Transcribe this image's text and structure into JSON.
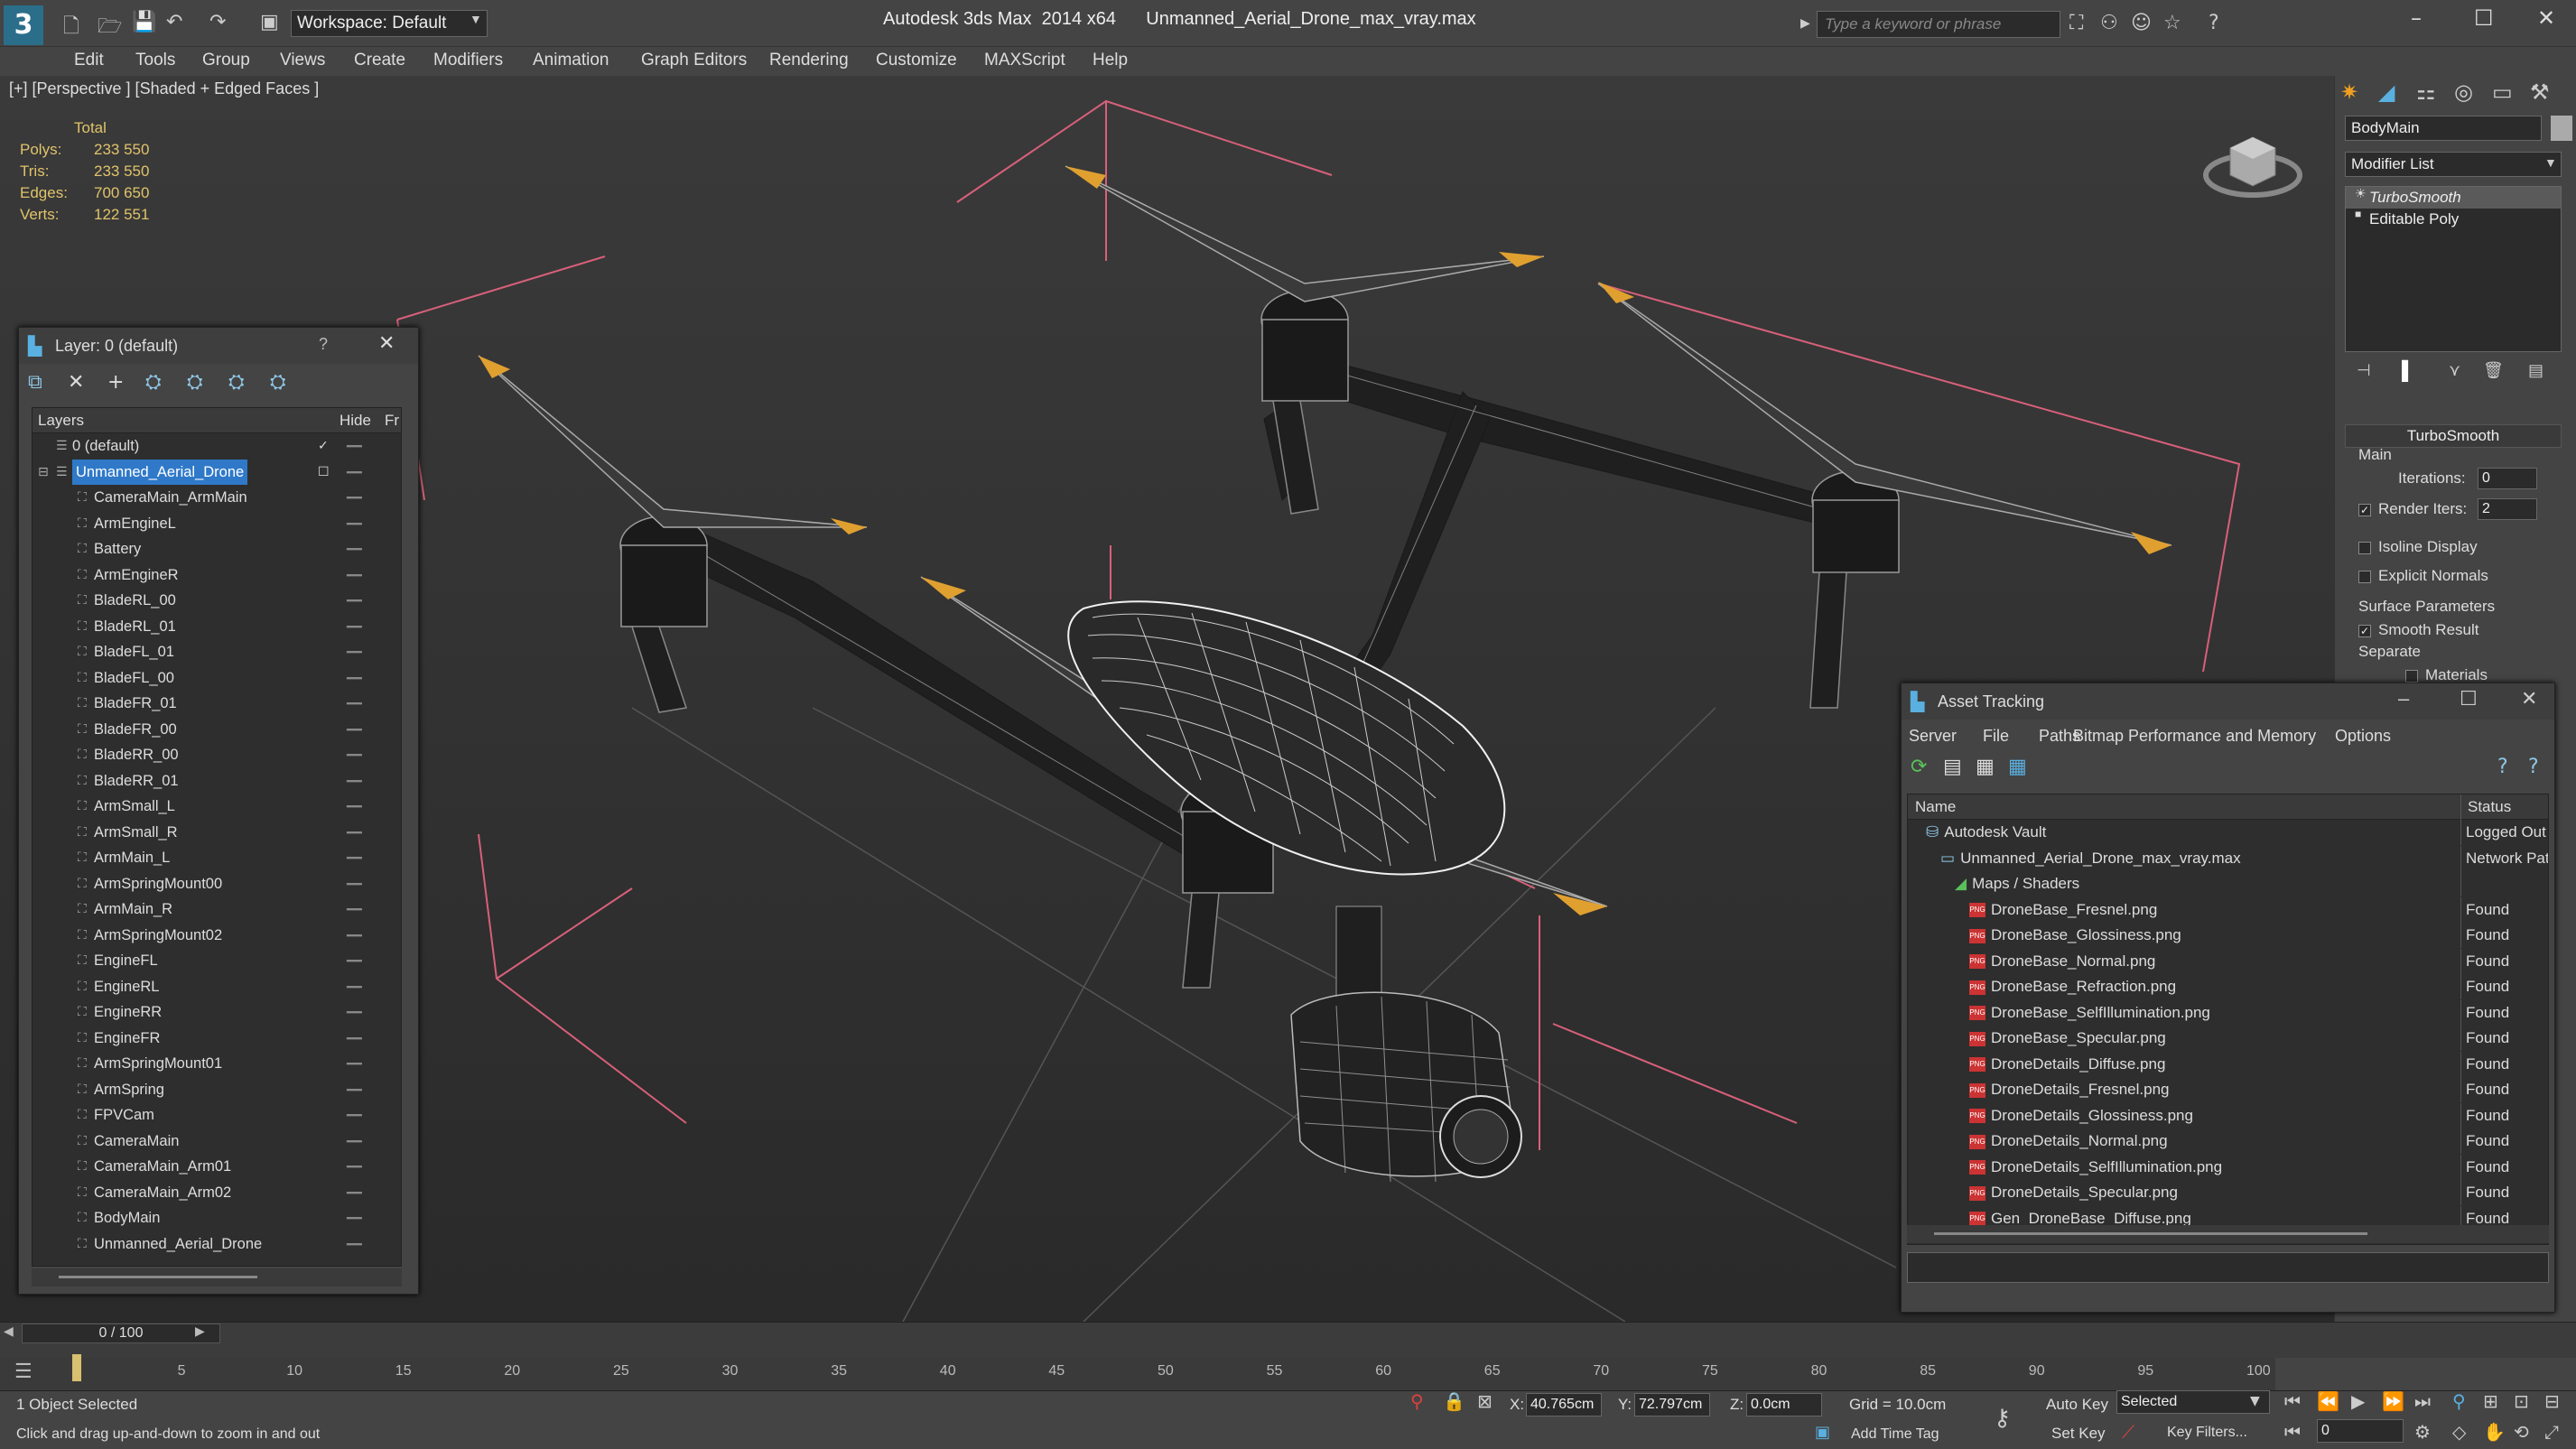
{
  "title": {
    "workspace": "Workspace: Default",
    "app": "Autodesk 3ds Max  2014 x64",
    "file": "Unmanned_Aerial_Drone_max_vray.max",
    "search_placeholder": "Type a keyword or phrase"
  },
  "menu": [
    "Edit",
    "Tools",
    "Group",
    "Views",
    "Create",
    "Modifiers",
    "Animation",
    "Graph Editors",
    "Rendering",
    "Customize",
    "MAXScript",
    "Help"
  ],
  "viewport": {
    "label": "[+] [Perspective ] [Shaded + Edged Faces ]",
    "stats_header": "Total",
    "stats": [
      {
        "k": "Polys:",
        "v": "233 550"
      },
      {
        "k": "Tris:",
        "v": "233 550"
      },
      {
        "k": "Edges:",
        "v": "700 650"
      },
      {
        "k": "Verts:",
        "v": "122 551"
      }
    ]
  },
  "layer_manager": {
    "title": "Layer: 0 (default)",
    "help": "?",
    "col_layers": "Layers",
    "col_hide": "Hide",
    "col_freeze": "Fr",
    "rows": [
      {
        "name": "0 (default)",
        "level": 1
      },
      {
        "name": "Unmanned_Aerial_Drone",
        "level": 1,
        "selected": true
      },
      {
        "name": "CameraMain_ArmMain",
        "level": 2
      },
      {
        "name": "ArmEngineL",
        "level": 2
      },
      {
        "name": "Battery",
        "level": 2
      },
      {
        "name": "ArmEngineR",
        "level": 2
      },
      {
        "name": "BladeRL_00",
        "level": 2
      },
      {
        "name": "BladeRL_01",
        "level": 2
      },
      {
        "name": "BladeFL_01",
        "level": 2
      },
      {
        "name": "BladeFL_00",
        "level": 2
      },
      {
        "name": "BladeFR_01",
        "level": 2
      },
      {
        "name": "BladeFR_00",
        "level": 2
      },
      {
        "name": "BladeRR_00",
        "level": 2
      },
      {
        "name": "BladeRR_01",
        "level": 2
      },
      {
        "name": "ArmSmall_L",
        "level": 2
      },
      {
        "name": "ArmSmall_R",
        "level": 2
      },
      {
        "name": "ArmMain_L",
        "level": 2
      },
      {
        "name": "ArmSpringMount00",
        "level": 2
      },
      {
        "name": "ArmMain_R",
        "level": 2
      },
      {
        "name": "ArmSpringMount02",
        "level": 2
      },
      {
        "name": "EngineFL",
        "level": 2
      },
      {
        "name": "EngineRL",
        "level": 2
      },
      {
        "name": "EngineRR",
        "level": 2
      },
      {
        "name": "EngineFR",
        "level": 2
      },
      {
        "name": "ArmSpringMount01",
        "level": 2
      },
      {
        "name": "ArmSpring",
        "level": 2
      },
      {
        "name": "FPVCam",
        "level": 2
      },
      {
        "name": "CameraMain",
        "level": 2
      },
      {
        "name": "CameraMain_Arm01",
        "level": 2
      },
      {
        "name": "CameraMain_Arm02",
        "level": 2
      },
      {
        "name": "BodyMain",
        "level": 2
      },
      {
        "name": "Unmanned_Aerial_Drone",
        "level": 2
      }
    ]
  },
  "command_panel": {
    "object_name": "BodyMain",
    "modifier_list": "Modifier List",
    "stack": [
      "TurboSmooth",
      "Editable Poly"
    ],
    "rollout_title": "TurboSmooth",
    "main_label": "Main",
    "iterations_label": "Iterations:",
    "iterations_value": "0",
    "render_iters_label": "Render Iters:",
    "render_iters_value": "2",
    "isoline": "Isoline Display",
    "explicit_normals": "Explicit Normals",
    "surface_params": "Surface Parameters",
    "smooth_result": "Smooth Result",
    "separate": "Separate",
    "materials": "Materials"
  },
  "asset_tracking": {
    "title": "Asset Tracking",
    "menu": [
      "Server",
      "File",
      "Paths",
      "Bitmap Performance and Memory",
      "Options"
    ],
    "col_name": "Name",
    "col_status": "Status",
    "rows": [
      {
        "name": "Autodesk Vault",
        "status": "Logged Out",
        "indent": 1,
        "icon": "vault"
      },
      {
        "name": "Unmanned_Aerial_Drone_max_vray.max",
        "status": "Network Pat",
        "indent": 2,
        "icon": "max"
      },
      {
        "name": "Maps / Shaders",
        "status": "",
        "indent": 3,
        "icon": "maps"
      },
      {
        "name": "DroneBase_Fresnel.png",
        "status": "Found",
        "indent": 4,
        "icon": "png"
      },
      {
        "name": "DroneBase_Glossiness.png",
        "status": "Found",
        "indent": 4,
        "icon": "png"
      },
      {
        "name": "DroneBase_Normal.png",
        "status": "Found",
        "indent": 4,
        "icon": "png"
      },
      {
        "name": "DroneBase_Refraction.png",
        "status": "Found",
        "indent": 4,
        "icon": "png"
      },
      {
        "name": "DroneBase_SelfIllumination.png",
        "status": "Found",
        "indent": 4,
        "icon": "png"
      },
      {
        "name": "DroneBase_Specular.png",
        "status": "Found",
        "indent": 4,
        "icon": "png"
      },
      {
        "name": "DroneDetails_Diffuse.png",
        "status": "Found",
        "indent": 4,
        "icon": "png"
      },
      {
        "name": "DroneDetails_Fresnel.png",
        "status": "Found",
        "indent": 4,
        "icon": "png"
      },
      {
        "name": "DroneDetails_Glossiness.png",
        "status": "Found",
        "indent": 4,
        "icon": "png"
      },
      {
        "name": "DroneDetails_Normal.png",
        "status": "Found",
        "indent": 4,
        "icon": "png"
      },
      {
        "name": "DroneDetails_SelfIllumination.png",
        "status": "Found",
        "indent": 4,
        "icon": "png"
      },
      {
        "name": "DroneDetails_Specular.png",
        "status": "Found",
        "indent": 4,
        "icon": "png"
      },
      {
        "name": "Gen_DroneBase_Diffuse.png",
        "status": "Found",
        "indent": 4,
        "icon": "png"
      }
    ],
    "png_badge": "PNG"
  },
  "timeline": {
    "frame": "0 / 100",
    "ticks": [
      "5",
      "10",
      "15",
      "20",
      "25",
      "30",
      "35",
      "40",
      "45",
      "50",
      "55",
      "60",
      "65",
      "70",
      "75",
      "80",
      "85",
      "90",
      "95",
      "100"
    ]
  },
  "status": {
    "selected": "1 Object Selected",
    "prompt": "Click and drag up-and-down to zoom in and out",
    "x_label": "X:",
    "x_value": "40.765cm",
    "y_label": "Y:",
    "y_value": "72.797cm",
    "z_label": "Z:",
    "z_value": "0.0cm",
    "grid": "Grid = 10.0cm",
    "add_time_tag": "Add Time Tag",
    "auto_key": "Auto Key",
    "set_key": "Set Key",
    "selected_dropdown": "Selected",
    "key_filters": "Key Filters...",
    "frame_field": "0"
  },
  "colors": {
    "accent": "#2f79c8",
    "stats": "#e0c36a",
    "wire": "#e0e0e0",
    "pink": "#d8607a",
    "blade": "#e0a030"
  }
}
